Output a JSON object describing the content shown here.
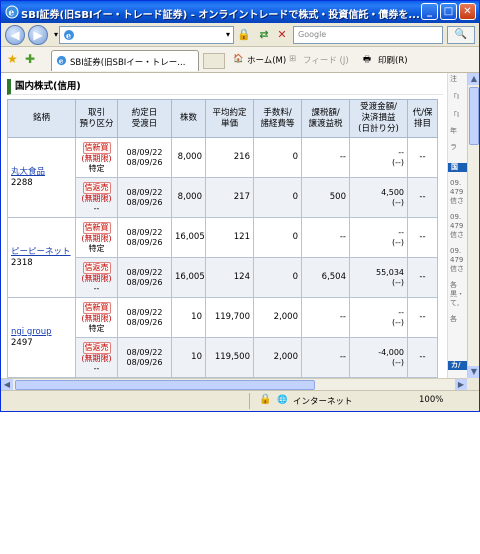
{
  "window": {
    "title": "SBI証券(旧SBIイー・トレード証券) - オンライントレードで株式・投資信託・債券を... - Wind...",
    "minimize": "_",
    "maximize": "□",
    "close": "✕"
  },
  "address_bar": {
    "back": "◀",
    "forward": "▶",
    "address_value": "",
    "search_placeholder": "Google",
    "search_go": "🔍"
  },
  "tab_bar": {
    "tab_label": "SBI証券(旧SBIイー・トレー...",
    "home_label": "ホーム(M)",
    "feed_label": "フィード (J)",
    "print_label": "印刷(R)"
  },
  "page": {
    "section_title": "国内株式(信用)",
    "columns": [
      "銘柄",
      "取引\n預り区分",
      "約定日\n受渡日",
      "株数",
      "平均約定\n単価",
      "手数料/\n諸経費等",
      "課税額/\n譲渡益税",
      "受渡金額/\n決済損益\n(日計り分)",
      "代/保\n排目"
    ],
    "stocks": [
      {
        "name": "丸大食品",
        "code": "2288",
        "rows": [
          {
            "trade": "信新買",
            "term": "(無期限)",
            "account": "特定",
            "dates": [
              "08/09/22",
              "08/09/26"
            ],
            "qty": "8,000",
            "price": "216",
            "fee": "0",
            "tax": "--",
            "amount": "--",
            "pl": "(--)",
            "extra": "--"
          },
          {
            "trade": "信返売",
            "term": "(無期限)",
            "account": "--",
            "dates": [
              "08/09/22",
              "08/09/26"
            ],
            "qty": "8,000",
            "price": "217",
            "fee": "0",
            "tax": "500",
            "amount": "4,500",
            "pl": "(--)",
            "extra": "--"
          }
        ]
      },
      {
        "name": "ピーピーネット",
        "code": "2318",
        "rows": [
          {
            "trade": "信新買",
            "term": "(無期限)",
            "account": "特定",
            "dates": [
              "08/09/22",
              "08/09/26"
            ],
            "qty": "16,005",
            "price": "121",
            "fee": "0",
            "tax": "--",
            "amount": "--",
            "pl": "(--)",
            "extra": "--"
          },
          {
            "trade": "信返売",
            "term": "(無期限)",
            "account": "--",
            "dates": [
              "08/09/22",
              "08/09/26"
            ],
            "qty": "16,005",
            "price": "124",
            "fee": "0",
            "tax": "6,504",
            "amount": "55,034",
            "pl": "(--)",
            "extra": "--"
          }
        ]
      },
      {
        "name": "ngi group",
        "code": "2497",
        "rows": [
          {
            "trade": "信新買",
            "term": "(無期限)",
            "account": "特定",
            "dates": [
              "08/09/22",
              "08/09/26"
            ],
            "qty": "10",
            "price": "119,700",
            "fee": "2,000",
            "tax": "--",
            "amount": "--",
            "pl": "(--)",
            "extra": "--"
          },
          {
            "trade": "信返売",
            "term": "(無期限)",
            "account": "--",
            "dates": [
              "08/09/22",
              "08/09/26"
            ],
            "qty": "10",
            "price": "119,500",
            "fee": "2,000",
            "tax": "--",
            "amount": "-4,000",
            "pl": "(--)",
            "extra": "--"
          }
        ]
      }
    ],
    "partial_next_row": "信新買"
  },
  "side_panel": {
    "texts": [
      "注",
      "「I",
      "「I",
      "年",
      "ラ"
    ],
    "header": "国",
    "items": [
      "09.",
      "479",
      "信さ",
      "09.",
      "479",
      "信さ",
      "09.",
      "479",
      "信さ",
      "各",
      "黒・",
      "て,",
      "各",
      "カ/"
    ]
  },
  "status_bar": {
    "zone_label": "インターネット",
    "zoom_label": "100%"
  },
  "colors": {
    "title_bar": "#0a58d8",
    "header_bg": "#dde7f3",
    "link": "#1a3fb0",
    "badge_red": "#c00000",
    "section_accent": "#2d7a2d"
  }
}
